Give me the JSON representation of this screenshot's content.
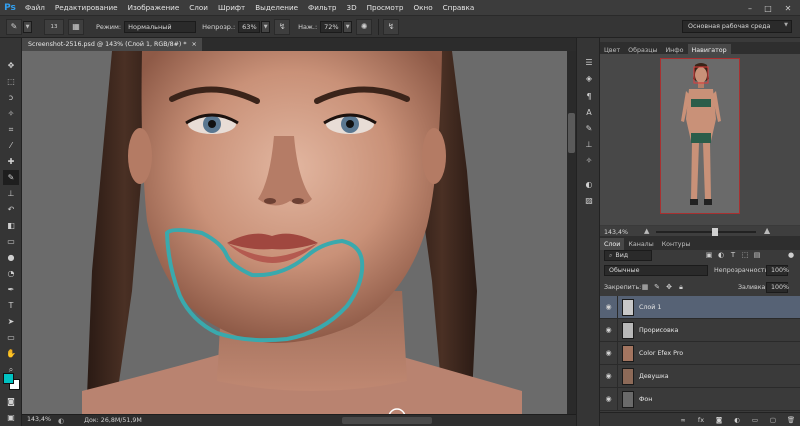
{
  "app": {
    "logo": "Ps"
  },
  "menu": [
    "Файл",
    "Редактирование",
    "Изображение",
    "Слои",
    "Шрифт",
    "Выделение",
    "Фильтр",
    "3D",
    "Просмотр",
    "Окно",
    "Справка"
  ],
  "window_controls": {
    "minimize": "–",
    "maximize": "□",
    "close": "✕"
  },
  "options": {
    "brush_size": "13",
    "mode_label": "Режим:",
    "mode_value": "Нормальный",
    "opacity_label": "Непрозр.:",
    "opacity_value": "63%",
    "flow_label": "Наж.:",
    "flow_value": "72%"
  },
  "workspace": "Основная рабочая среда",
  "document": {
    "tab_title": "Screenshot-2516.psd @ 143% (Слой 1, RGB/8#) *",
    "tab_close": "×",
    "zoom": "143,4%",
    "info": "Док: 26,8M/51,9M"
  },
  "panels": {
    "top_tabs": [
      "Цвет",
      "Образцы",
      "Инфо",
      "Навигатор"
    ],
    "active_top_tab": "Навигатор",
    "navigator_zoom": "143,4%",
    "layer_tabs": [
      "Слои",
      "Каналы",
      "Контуры"
    ],
    "active_layer_tab": "Слои",
    "filter_kind": "Вид",
    "blend_mode": "Обычные",
    "opacity_label": "Непрозрачность:",
    "opacity_value": "100%",
    "lock_label": "Закрепить:",
    "fill_label": "Заливка:",
    "fill_value": "100%"
  },
  "layers": [
    {
      "name": "Слой 1",
      "selected": true,
      "thumb": "#c8c8c8"
    },
    {
      "name": "Прорисовка",
      "selected": false,
      "thumb": "#b8b8b8"
    },
    {
      "name": "Color Efex Pro",
      "selected": false,
      "thumb": "#a37560"
    },
    {
      "name": "Девушка",
      "selected": false,
      "thumb": "#8d6a58"
    },
    {
      "name": "Фон",
      "selected": false,
      "thumb": "#6a6a6a"
    }
  ],
  "colors": {
    "foreground": "#00c2c2",
    "background": "#ffffff",
    "selection_stroke": "#3aa9ad",
    "skin": "#c99178"
  },
  "icons": {
    "tools": [
      "move-icon",
      "marquee-icon",
      "lasso-icon",
      "quick-selection-icon",
      "crop-icon",
      "eyedropper-icon",
      "healing-brush-icon",
      "brush-icon",
      "clone-stamp-icon",
      "history-brush-icon",
      "eraser-icon",
      "gradient-icon",
      "blur-icon",
      "dodge-icon",
      "pen-icon",
      "type-icon",
      "path-selection-icon",
      "rectangle-icon",
      "hand-icon",
      "zoom-icon"
    ]
  }
}
